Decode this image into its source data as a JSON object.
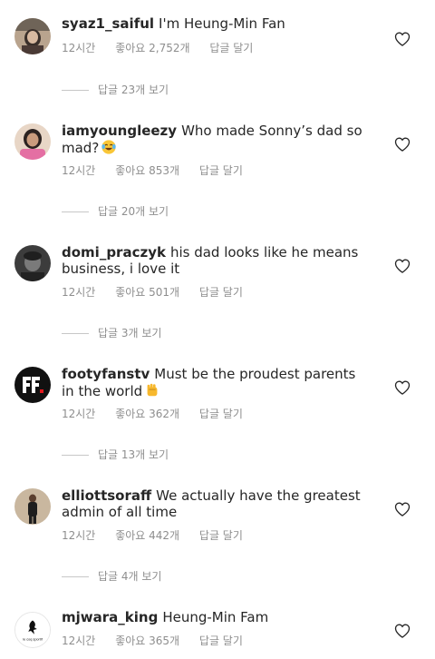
{
  "comments": [
    {
      "username": "syaz1_saiful",
      "text": "I'm Heung-Min Fan",
      "time": "12시간",
      "likes": "좋아요 2,752개",
      "reply": "답글 달기",
      "view_replies": "답글 23개 보기"
    },
    {
      "username": "iamyoungleezy",
      "text": "Who made Sonny’s dad so mad?",
      "emoji": "laughing-tears-emoji",
      "time": "12시간",
      "likes": "좋아요 853개",
      "reply": "답글 달기",
      "view_replies": "답글 20개 보기"
    },
    {
      "username": "domi_praczyk",
      "text": "his dad looks like he means business, i love it",
      "time": "12시간",
      "likes": "좋아요 501개",
      "reply": "답글 달기",
      "view_replies": "답글 3개 보기"
    },
    {
      "username": "footyfanstv",
      "text": "Must be the proudest parents in the world",
      "emoji": "raised-fist-emoji",
      "time": "12시간",
      "likes": "좋아요 362개",
      "reply": "답글 달기",
      "view_replies": "답글 13개 보기"
    },
    {
      "username": "elliottsoraff",
      "text": "We actually have the greatest admin of all time",
      "time": "12시간",
      "likes": "좋아요 442개",
      "reply": "답글 달기",
      "view_replies": "답글 4개 보기"
    },
    {
      "username": "mjwara_king",
      "text": "Heung-Min Fam",
      "time": "12시간",
      "likes": "좋아요 365개",
      "reply": "답글 달기"
    }
  ],
  "avatar_5_logo_text": "le coq sportif",
  "icons": {
    "like": "heart-outline-icon"
  },
  "colors": {
    "text": "#262626",
    "muted": "#8e8e8e",
    "divider": "#c7c7c7"
  }
}
